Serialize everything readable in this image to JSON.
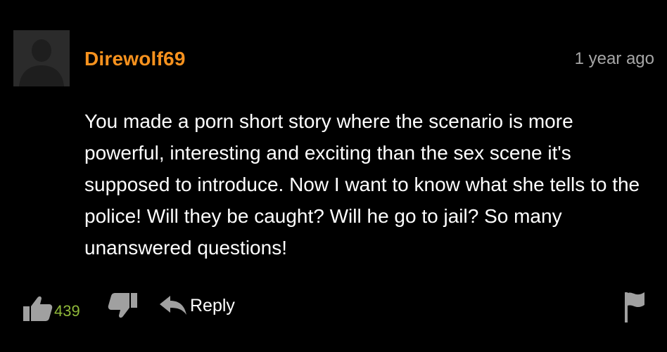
{
  "comment": {
    "username": "Direwolf69",
    "timestamp": "1 year ago",
    "text": "You made a porn short story where the scenario is more powerful, interesting and exciting than the sex scene it's supposed to introduce. Now I want to know what she tells to the police! Will they be caught? Will he go to jail? So many unanswered questions!",
    "avatar_icon": "default-user-silhouette",
    "actions": {
      "like_icon": "thumbs-up-icon",
      "like_count": "439",
      "dislike_icon": "thumbs-down-icon",
      "reply_icon": "reply-arrow-icon",
      "reply_label": "Reply",
      "flag_icon": "flag-icon"
    },
    "colors": {
      "background": "#000000",
      "username": "#f7921e",
      "like_count": "#8fb83a",
      "timestamp": "#a6a6a6",
      "icons": "#a0a0a0"
    }
  }
}
